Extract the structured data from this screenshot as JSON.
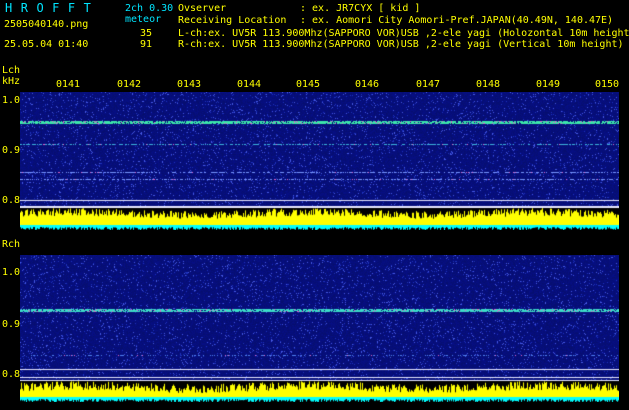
{
  "header": {
    "brand": "HROFFT",
    "mode": "2ch 0.30",
    "filename": "2505040140.png",
    "meteor_label": "meteor",
    "datetime": "25.05.04 01:40",
    "count_l": "35",
    "count_r": "91",
    "observer_key": "Ovserver",
    "observer_value": ": ex. JR7CYX [ kid ]",
    "location_key": "Receiving Location",
    "location_value": ": ex. Aomori City Aomori-Pref.JAPAN(40.49N, 140.47E)",
    "lch_info": "L-ch:ex. UV5R 113.900Mhz(SAPPORO VOR)USB ,2-ele yagi (Holozontal 10m height)",
    "rch_info": "R-ch:ex. UV5R 113.900Mhz(SAPPORO VOR)USB ,2-ele yagi (Vertical 10m height)"
  },
  "time_labels": [
    "0141",
    "0142",
    "0143",
    "0144",
    "0145",
    "0146",
    "0147",
    "0148",
    "0149",
    "0150"
  ],
  "left_channel": {
    "label": "Lch",
    "unit": "kHz",
    "freq_ticks": [
      "1.0",
      "0.9",
      "0.8"
    ]
  },
  "right_channel": {
    "label": "Rch",
    "freq_ticks": [
      "1.0",
      "0.9",
      "0.8"
    ]
  },
  "colors": {
    "text_primary": "#ffff00",
    "text_secondary": "#00e5ff",
    "background": "#000000",
    "spectrogram_bg": "#08107a",
    "level_bar": "#ffff00",
    "level_base": "#00ffff"
  }
}
